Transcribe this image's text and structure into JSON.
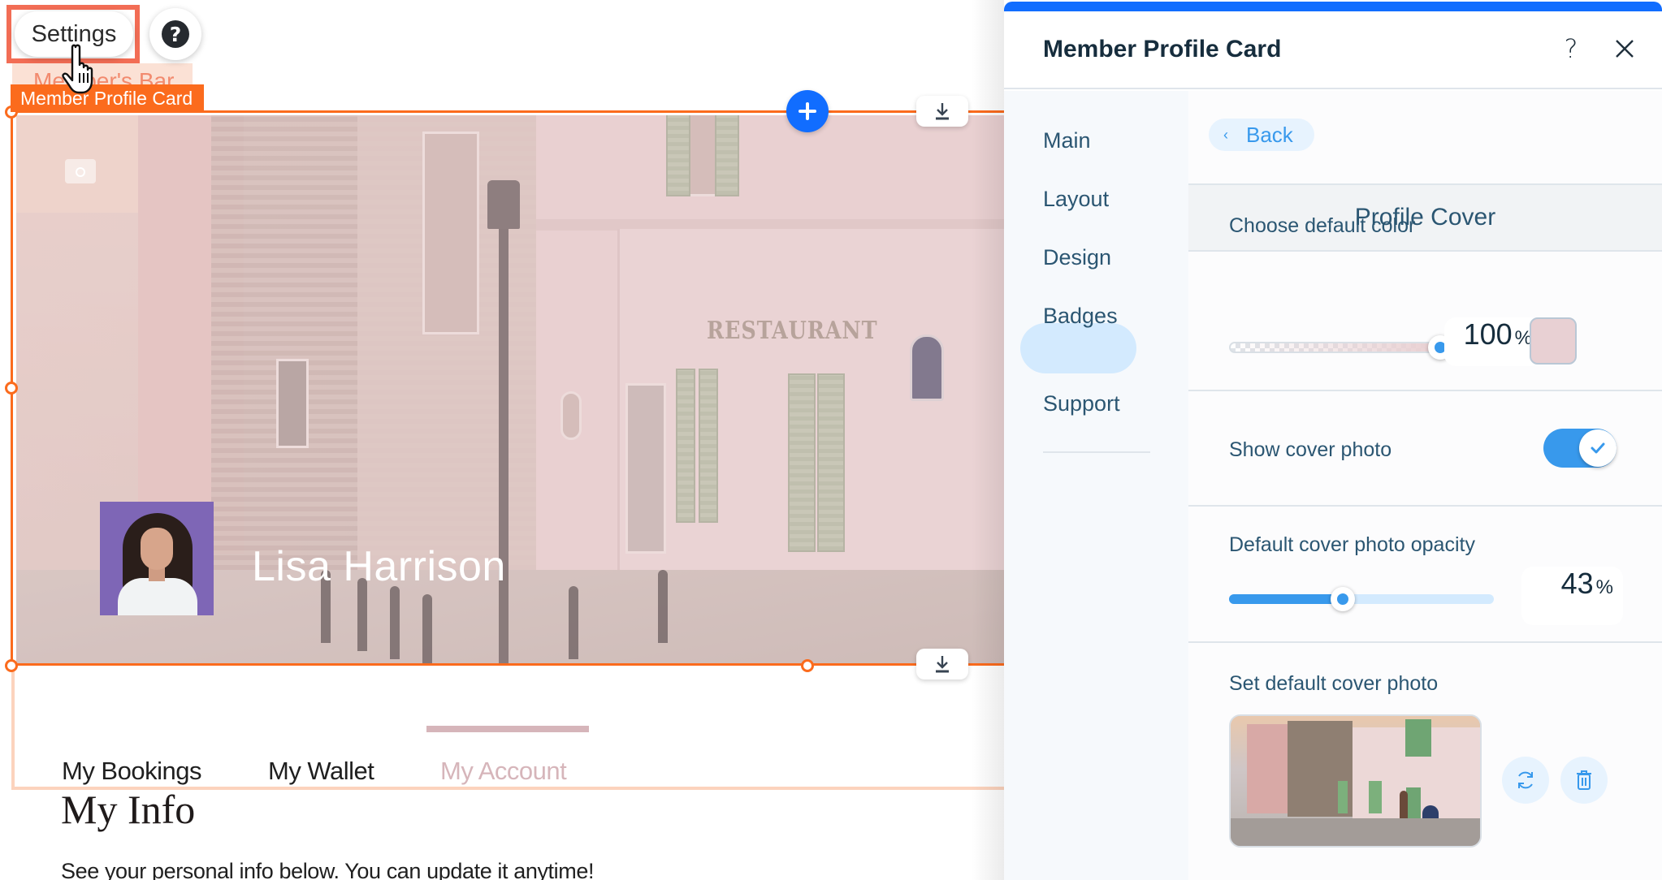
{
  "editor": {
    "settings_button": "Settings",
    "help_icon": "question-circle",
    "ghost_element_label": "Member's Bar",
    "component_label": "Member Profile Card",
    "accent_color": "#fb6b1d",
    "add_button_icon": "plus",
    "profile": {
      "name": "Lisa Harrison"
    },
    "tabs": [
      {
        "label": "My Bookings",
        "active": false
      },
      {
        "label": "My Wallet",
        "active": false
      },
      {
        "label": "My Account",
        "active": true
      }
    ],
    "page_heading": "My Info",
    "page_text": "See your personal info below. You can update it anytime!"
  },
  "panel": {
    "title": "Member Profile Card",
    "help_label": "?",
    "nav": [
      {
        "label": "Main",
        "active": false
      },
      {
        "label": "Layout",
        "active": false
      },
      {
        "label": "Design",
        "active": true
      },
      {
        "label": "Badges",
        "active": false
      },
      {
        "label": "Support",
        "active": false
      }
    ],
    "back_label": "Back",
    "section_title": "Profile Cover",
    "default_color": {
      "label": "Choose default color",
      "opacity_value": "100",
      "opacity_percent": 100,
      "unit": "%",
      "swatch_color": "#e8d0d3"
    },
    "show_cover_photo": {
      "label": "Show cover photo",
      "enabled": true
    },
    "cover_opacity": {
      "label": "Default cover photo opacity",
      "value": "43",
      "percent": 43,
      "unit": "%"
    },
    "cover_photo": {
      "label": "Set default cover photo",
      "replace_icon": "refresh",
      "delete_icon": "trash"
    },
    "brand_blue": "#116dff",
    "control_blue": "#3899ec"
  }
}
